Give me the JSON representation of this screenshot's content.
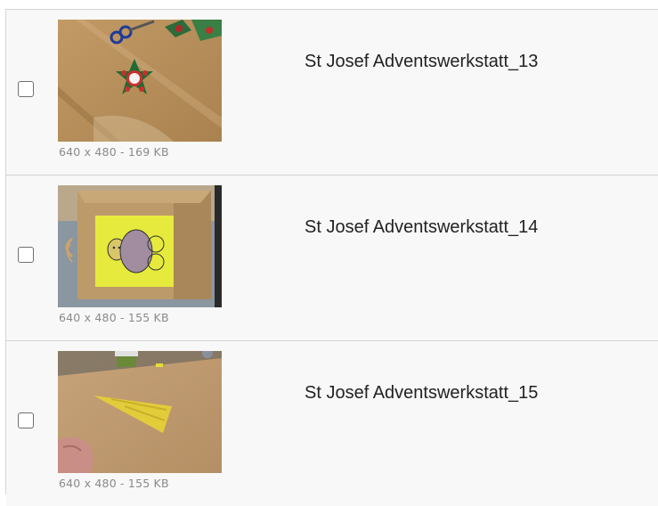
{
  "files": [
    {
      "title": "St Josef Adventswerkstatt_13",
      "meta": "640 x 480 - 169 KB",
      "thumb_icon": "image-thumbnail",
      "checked": false
    },
    {
      "title": "St Josef Adventswerkstatt_14",
      "meta": "640 x 480 - 155 KB",
      "thumb_icon": "image-thumbnail",
      "checked": false
    },
    {
      "title": "St Josef Adventswerkstatt_15",
      "meta": "640 x 480 - 155 KB",
      "thumb_icon": "image-thumbnail",
      "checked": false
    }
  ]
}
